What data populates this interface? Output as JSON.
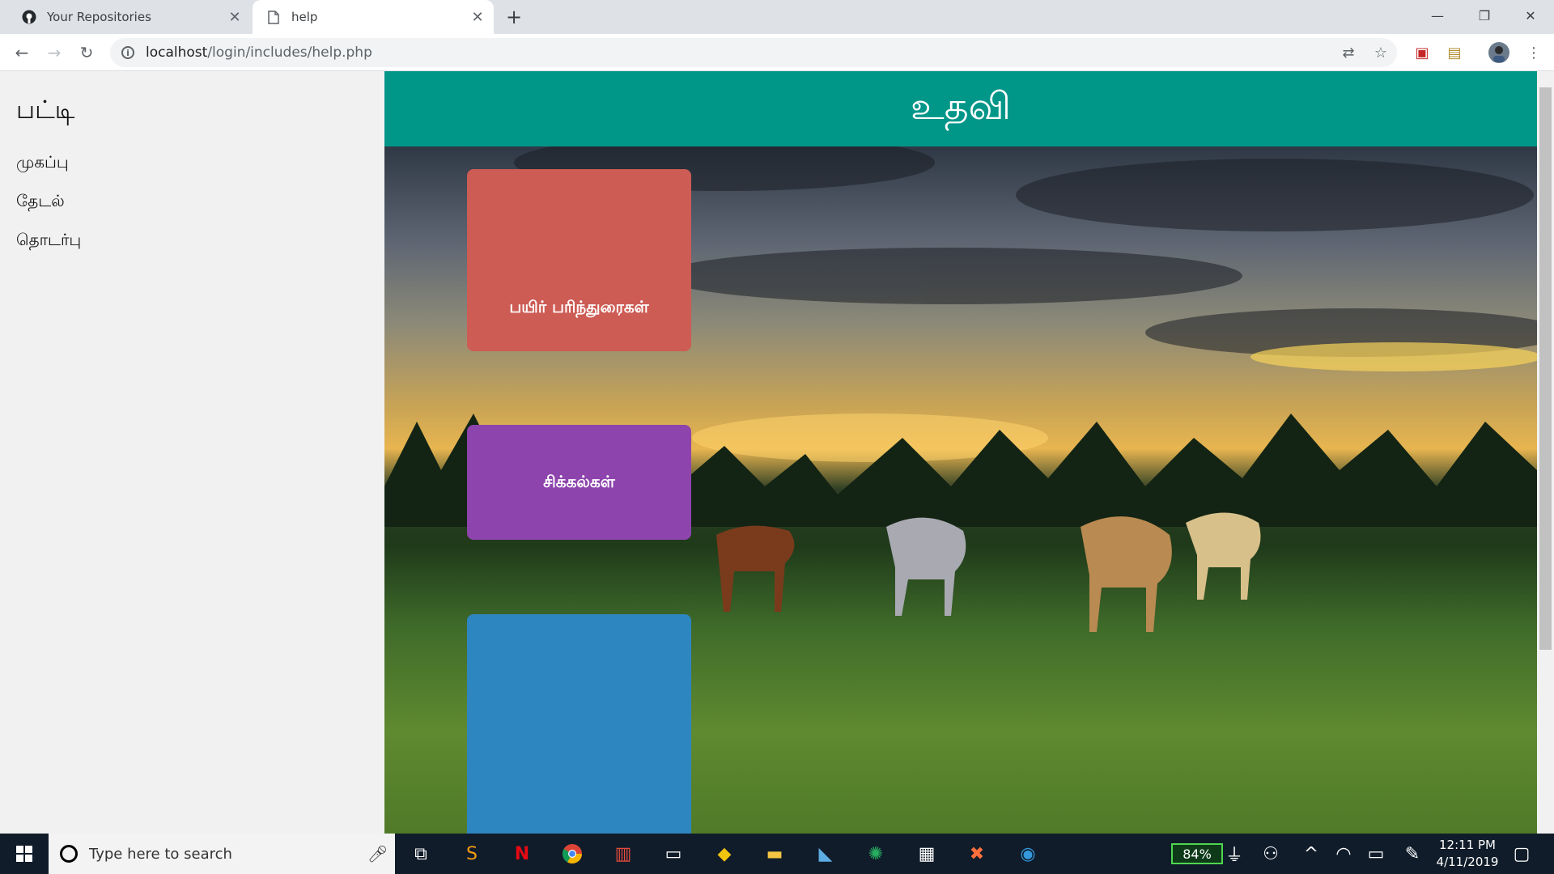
{
  "browser": {
    "tabs": [
      {
        "title": "Your Repositories",
        "icon": "github-icon"
      },
      {
        "title": "help",
        "icon": "page-icon"
      }
    ],
    "url_host": "localhost",
    "url_path": "/login/includes/help.php"
  },
  "sidebar": {
    "title": "பட்டி",
    "items": [
      {
        "label": "முகப்பு"
      },
      {
        "label": "தேடல்"
      },
      {
        "label": "தொடர்பு"
      }
    ]
  },
  "page": {
    "header": "உதவி",
    "header_color": "#009688",
    "cards": [
      {
        "label": "பயிர் பரிந்துரைகள்",
        "color": "#cd5c54"
      },
      {
        "label": "சிக்கல்கள்",
        "color": "#8e44ad"
      },
      {
        "label": "",
        "color": "#2e86c1"
      }
    ]
  },
  "taskbar": {
    "search_placeholder": "Type here to search",
    "battery": "84%",
    "time": "12:11 PM",
    "date": "4/11/2019"
  }
}
